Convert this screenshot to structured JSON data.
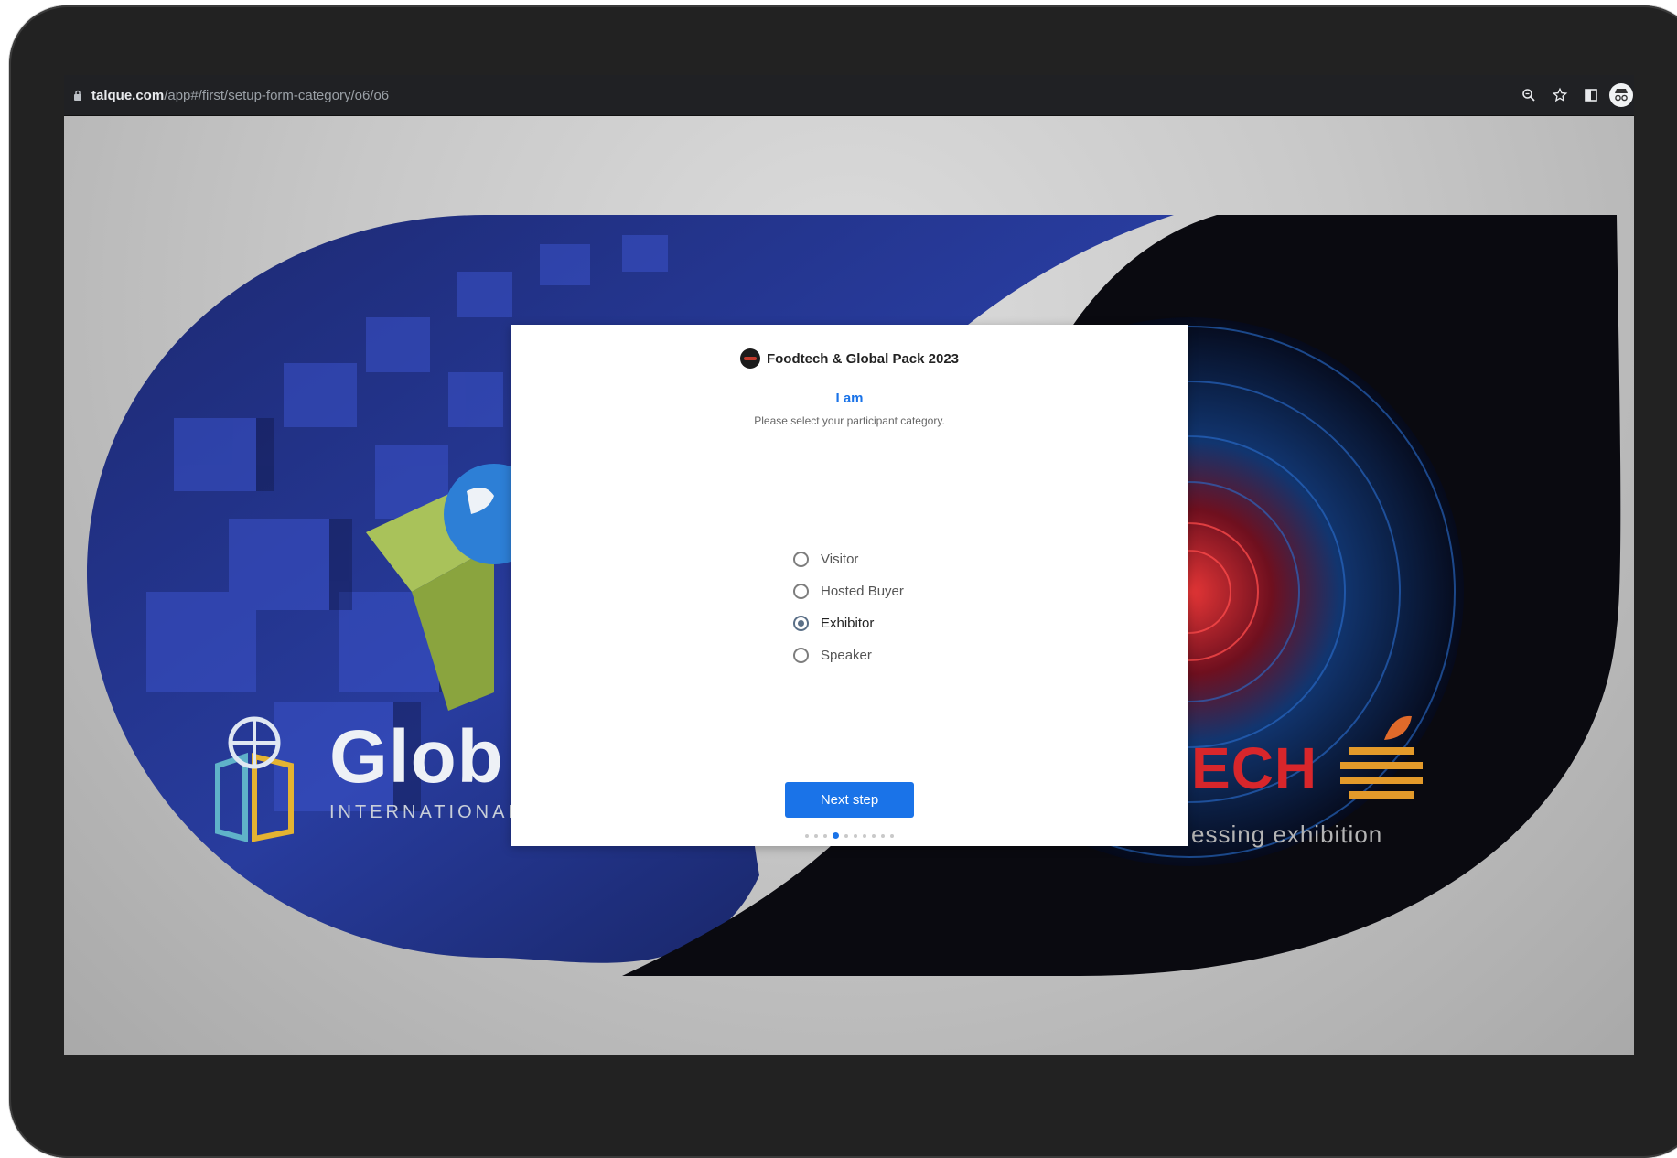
{
  "browser": {
    "url_host": "talque.com",
    "url_path": "/app#/first/setup-form-category/o6/o6",
    "icons": [
      "lock-icon",
      "zoom-icon",
      "star-icon",
      "sidepanel-icon",
      "profile-avatar"
    ]
  },
  "background": {
    "left_logo_word": "Glob",
    "left_logo_sub": "INTERNATIONAL",
    "right_logo_word": "ECH",
    "right_logo_sub": "essing exhibition"
  },
  "modal": {
    "event_title": "Foodtech & Global Pack 2023",
    "heading": "I am",
    "hint": "Please select your participant category.",
    "options": [
      {
        "label": "Visitor",
        "selected": false
      },
      {
        "label": "Hosted Buyer",
        "selected": false
      },
      {
        "label": "Exhibitor",
        "selected": true
      },
      {
        "label": "Speaker",
        "selected": false
      }
    ],
    "next_label": "Next step",
    "steps_total": 10,
    "step_current": 4
  },
  "colors": {
    "accent": "#1a73e8",
    "frame": "#222222",
    "radio_checked": "#5a6f87"
  }
}
